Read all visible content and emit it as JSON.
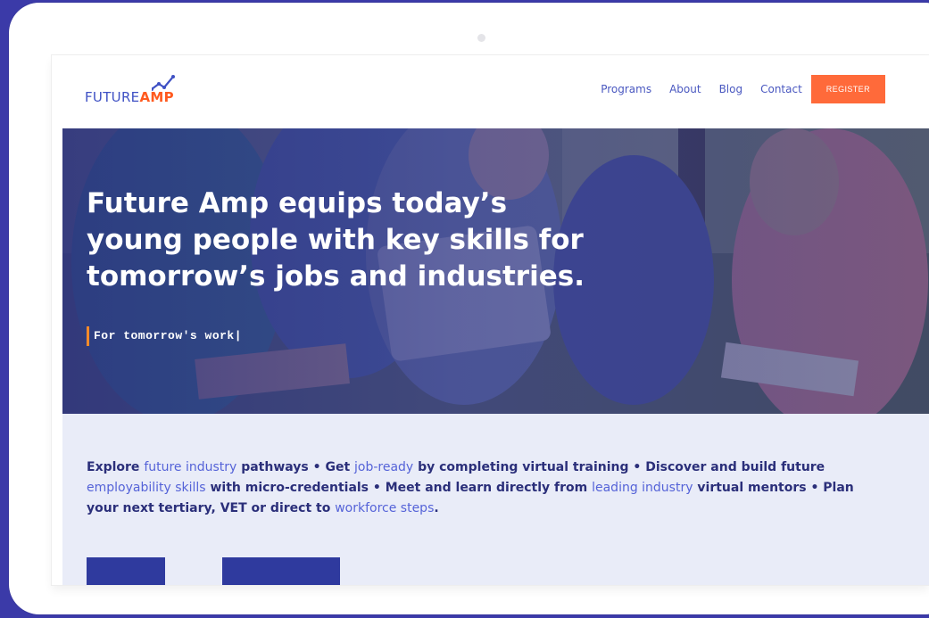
{
  "logo": {
    "part1": "FUTURE",
    "part2": "AMP"
  },
  "nav": {
    "items": [
      {
        "label": "Programs"
      },
      {
        "label": "About"
      },
      {
        "label": "Blog"
      },
      {
        "label": "Contact"
      }
    ],
    "register_label": "REGISTER"
  },
  "hero": {
    "title": "Future Amp equips today’s young people with key skills for tomorrow’s jobs and industries.",
    "typing_text": "For tomorrow's work",
    "cursor": "|"
  },
  "intro": {
    "segments": [
      {
        "text": "Explore ",
        "highlight": false
      },
      {
        "text": "future industry",
        "highlight": true
      },
      {
        "text": " pathways • Get ",
        "highlight": false
      },
      {
        "text": "job-ready",
        "highlight": true
      },
      {
        "text": " by completing virtual training • Discover and build future ",
        "highlight": false
      },
      {
        "text": "employability skills",
        "highlight": true
      },
      {
        "text": " with micro-credentials • Meet and learn directly from ",
        "highlight": false
      },
      {
        "text": "leading industry",
        "highlight": true
      },
      {
        "text": " virtual mentors • Plan your next tertiary, VET or direct to ",
        "highlight": false
      },
      {
        "text": "workforce steps",
        "highlight": true
      },
      {
        "text": ".",
        "highlight": false
      }
    ]
  },
  "colors": {
    "brand_blue": "#3f51c4",
    "accent_orange": "#ff6a3a",
    "page_background": "#3b3aa8",
    "section_bg": "#e9ecf8",
    "button_navy": "#2f3a9e"
  }
}
